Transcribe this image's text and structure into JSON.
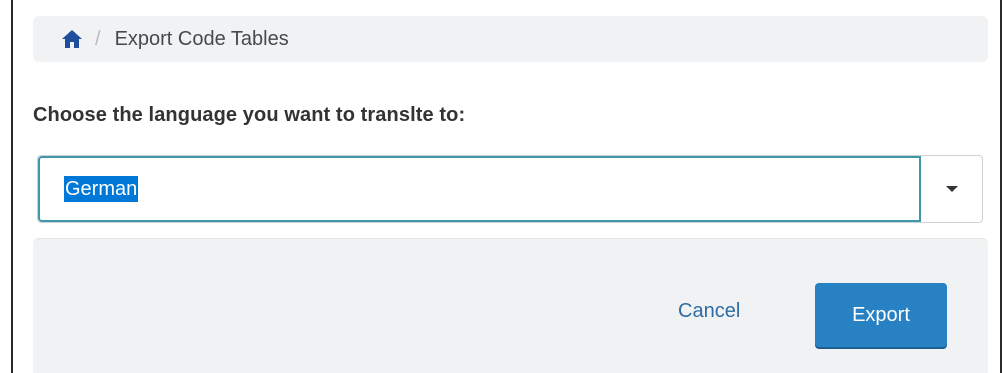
{
  "breadcrumb": {
    "home_icon": "home-icon",
    "separator": "/",
    "current": "Export Code Tables"
  },
  "form": {
    "prompt": "Choose the language you want to translte to:",
    "language_select": {
      "value": "German",
      "dropdown_icon": "chevron-down-icon"
    }
  },
  "footer": {
    "cancel_label": "Cancel",
    "export_label": "Export"
  },
  "colors": {
    "primary": "#2781c3",
    "link": "#2e6da4",
    "focus_border": "#3f97a7",
    "panel_bg": "#f1f2f3",
    "home_icon": "#1f4e9c"
  }
}
